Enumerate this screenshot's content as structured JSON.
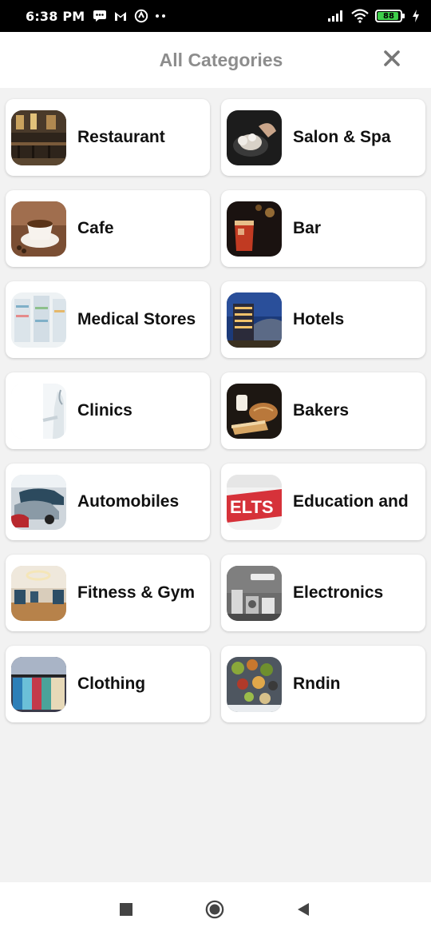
{
  "status_bar": {
    "time": "6:38 PM",
    "battery": "88",
    "icons": [
      "message-icon",
      "gmail-icon",
      "app-icon",
      "more-dots-icon",
      "signal-icon",
      "wifi-icon",
      "battery-icon",
      "charging-icon"
    ]
  },
  "header": {
    "title": "All Categories",
    "close_icon": "close-icon"
  },
  "categories": [
    {
      "label": "Restaurant"
    },
    {
      "label": "Salon & Spa"
    },
    {
      "label": "Cafe"
    },
    {
      "label": "Bar"
    },
    {
      "label": "Medical Stores"
    },
    {
      "label": "Hotels"
    },
    {
      "label": "Clinics"
    },
    {
      "label": "Bakers"
    },
    {
      "label": "Automobiles"
    },
    {
      "label": "Education and"
    },
    {
      "label": "Fitness & Gym"
    },
    {
      "label": "Electronics"
    },
    {
      "label": "Clothing"
    },
    {
      "label": "Rndin"
    }
  ],
  "nav_bar": {
    "icons": [
      "recents-square-icon",
      "home-circle-icon",
      "back-triangle-icon"
    ]
  }
}
